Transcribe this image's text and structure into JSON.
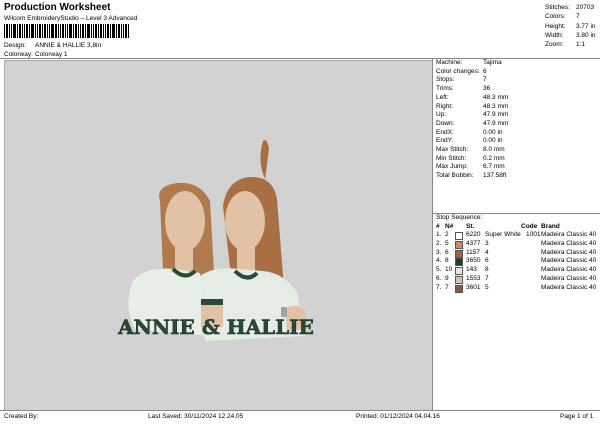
{
  "header": {
    "title": "Production Worksheet",
    "software": "Wilcom EmbroideryStudio – Level 3 Advanced",
    "design_label": "Design:",
    "design_value": "ANNIE & HALLIE 3,8in",
    "colorway_label": "Colorway:",
    "colorway_value": "Colorway 1"
  },
  "stats": [
    {
      "label": "Stitches:",
      "value": "20703"
    },
    {
      "label": "Colors:",
      "value": "7"
    },
    {
      "label": "Height:",
      "value": "3.77 in"
    },
    {
      "label": "Width:",
      "value": "3.80 in"
    },
    {
      "label": "Zoom:",
      "value": "1:1"
    }
  ],
  "machine_info": [
    {
      "label": "Machine:",
      "value": "Tajima"
    },
    {
      "label": "Color changes:",
      "value": "6"
    },
    {
      "label": "Stops:",
      "value": "7"
    },
    {
      "label": "Trims:",
      "value": "36"
    },
    {
      "label": "Left:",
      "value": "48.3 mm"
    },
    {
      "label": "Right:",
      "value": "48.3 mm"
    },
    {
      "label": "Up:",
      "value": "47.9 mm"
    },
    {
      "label": "Down:",
      "value": "47.9 mm"
    },
    {
      "label": "EndX:",
      "value": "0.00 in"
    },
    {
      "label": "EndY:",
      "value": "0.00 in"
    },
    {
      "label": "Max Stitch:",
      "value": "8.0 mm"
    },
    {
      "label": "Min Stitch:",
      "value": "0.2 mm"
    },
    {
      "label": "Max Jump:",
      "value": "6.7 mm"
    },
    {
      "label": "Total Bobbin:",
      "value": "137.58ft"
    }
  ],
  "stop_sequence": {
    "title": "Stop Sequence:",
    "headers": [
      "#",
      "N#",
      "St.",
      "Code",
      "Brand"
    ],
    "rows": [
      {
        "num": "1.",
        "n": "2",
        "color": "#ffffff",
        "st": "6220",
        "name": "Super White",
        "code": "1001",
        "brand": "Madeira Classic 40"
      },
      {
        "num": "2.",
        "n": "5",
        "color": "#c9896d",
        "st": "4377",
        "name": "3",
        "code": "",
        "brand": "Madeira Classic 40"
      },
      {
        "num": "3.",
        "n": "6",
        "color": "#a55f48",
        "st": "1157",
        "name": "4",
        "code": "",
        "brand": "Madeira Classic 40"
      },
      {
        "num": "4.",
        "n": "8",
        "color": "#1f3d2f",
        "st": "3650",
        "name": "6",
        "code": "",
        "brand": "Madeira Classic 40"
      },
      {
        "num": "5.",
        "n": "10",
        "color": "#e8e6dc",
        "st": "143",
        "name": "8",
        "code": "",
        "brand": "Madeira Classic 40"
      },
      {
        "num": "6.",
        "n": "9",
        "color": "#d8c3b2",
        "st": "1553",
        "name": "7",
        "code": "",
        "brand": "Madeira Classic 40"
      },
      {
        "num": "7.",
        "n": "7",
        "color": "#8b5a3c",
        "st": "3601",
        "name": "5",
        "code": "",
        "brand": "Madeira Classic 40"
      }
    ]
  },
  "design_text": "ANNIE & HALLIE",
  "footer": {
    "created": "Created By:",
    "saved": "Last Saved: 30/11/2024 12.24.05",
    "printed": "Printed: 01/12/2024 04.04.16",
    "page": "Page 1 of 1"
  },
  "colors": {
    "hair": "#b07a4f",
    "skin": "#e2c2a4",
    "shirt": "#e7eee8",
    "trim": "#2a4a35",
    "canvas": "#d2d2d2"
  }
}
